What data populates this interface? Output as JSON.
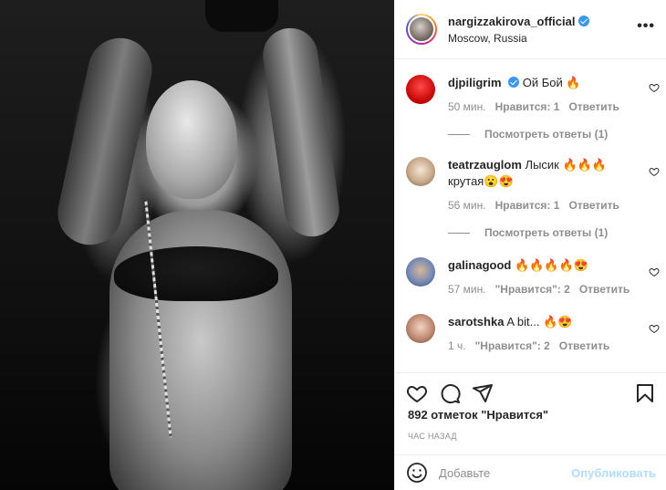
{
  "post": {
    "username": "nargizzakirova_official",
    "location": "Moscow, Russia",
    "more_label": "•••"
  },
  "comments": [
    {
      "user": "djpiligrim",
      "verified": true,
      "text": "Ой Бой 🔥",
      "time": "50 мин.",
      "likes": "Нравится: 1",
      "reply": "Ответить",
      "view_replies": "Посмотреть ответы (1)"
    },
    {
      "user": "teatrzauglom",
      "verified": false,
      "text": "Лысик 🔥🔥🔥 крутая😮😍",
      "time": "56 мин.",
      "likes": "Нравится: 1",
      "reply": "Ответить",
      "view_replies": "Посмотреть ответы (1)"
    },
    {
      "user": "galinagood",
      "verified": false,
      "text": "🔥🔥🔥🔥😍",
      "time": "57 мин.",
      "likes": "\"Нравится\": 2",
      "reply": "Ответить"
    },
    {
      "user": "sarotshka",
      "verified": false,
      "text": "A bit... 🔥😍",
      "time": "1 ч.",
      "likes": "\"Нравится\": 2",
      "reply": "Ответить"
    }
  ],
  "actions": {
    "likes_count": "892 отметок \"Нравится\"",
    "time_ago": "ЧАС НАЗАД"
  },
  "comment_box": {
    "placeholder": "Добавьте",
    "post_label": "Опубликовать"
  },
  "colors": {
    "verified": "#3897f0",
    "post_button_disabled": "#b3dbff",
    "muted_text": "#8e8e8e"
  },
  "icons": [
    "heart-icon",
    "comment-icon",
    "share-icon",
    "bookmark-icon",
    "smile-icon",
    "more-icon",
    "verified-icon"
  ]
}
